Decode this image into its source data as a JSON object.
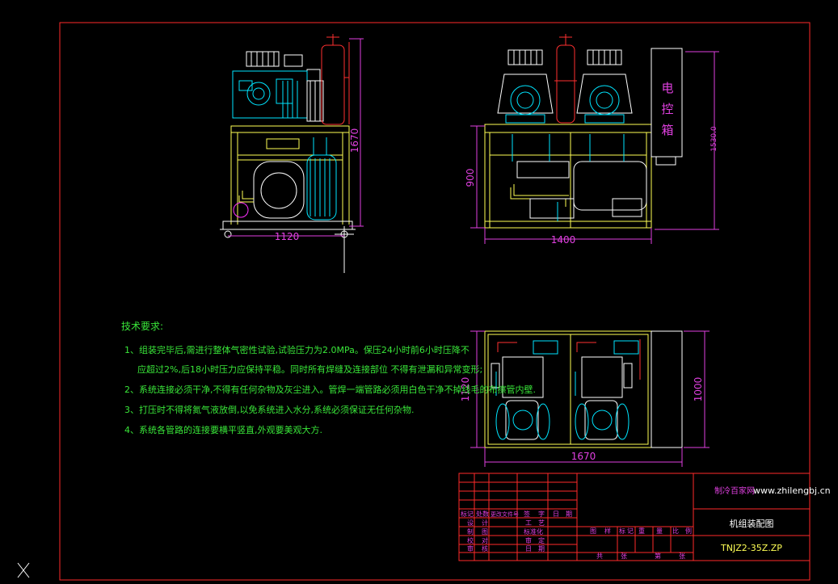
{
  "colors": {
    "frame": "#ff2a2a",
    "equipment": "#ffffff",
    "pipe_cyan": "#00e5ff",
    "pipe_yellow": "#ffff55",
    "pipe_red": "#ff3030",
    "dimension": "#e040e0",
    "notes": "#39e639",
    "background": "#000000"
  },
  "side_view": {
    "height_dim": "1670",
    "width_dim": "1120"
  },
  "front_view": {
    "height_dim": "900",
    "total_height_dim": "1530.0",
    "width_dim": "1400",
    "control_box_label": [
      "电",
      "控",
      "箱"
    ]
  },
  "top_view": {
    "depth_dim": "1120",
    "box_depth_dim": "1000",
    "width_dim": "1670"
  },
  "notes": {
    "title": "技术要求:",
    "lines": [
      "1、组装完毕后,需进行整体气密性试验,试验压力为2.0MPa。保压24小时前6小时压降不",
      "应超过2%,后18小时压力应保持平稳。同时所有焊缝及连接部位 不得有泄漏和异常变形;",
      "2、系统连接必须干净,不得有任何杂物及灰尘进入。管焊一端管路必须用白色干净不掉线毛的布擦管内壁.",
      "3、打压时不得将氮气液放倒,以免系统进入水分,系统必须保证无任何杂物.",
      "4、系统各管路的连接要横平竖直,外观要美观大方."
    ]
  },
  "title_block": {
    "company": "制冷百家网",
    "website": "www.zhilengbj.cn",
    "drawing_name": "机组装配图",
    "drawing_no": "TNJZ2-35Z.ZP",
    "row_labels_1": [
      "标记",
      "处数",
      "更改文件号",
      "签",
      "字",
      "日",
      "期"
    ],
    "row_labels_2": [
      "设",
      "计",
      "工",
      "艺"
    ],
    "row_labels_3": [
      "制",
      "图",
      "标准化"
    ],
    "row_labels_4": [
      "校",
      "对",
      "审",
      "定"
    ],
    "row_labels_5": [
      "审",
      "核",
      "日",
      "期"
    ],
    "mid_labels": [
      "图",
      "样",
      "标",
      "记",
      "重",
      "量",
      "比",
      "例"
    ],
    "bottom_labels": [
      "共",
      "张",
      "第",
      "张"
    ]
  }
}
